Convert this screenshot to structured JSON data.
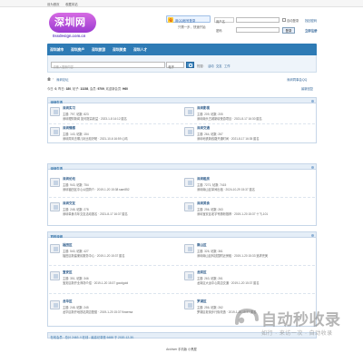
{
  "topbar": {
    "set_home": "设为首页",
    "bookmark": "收藏本站"
  },
  "logo": {
    "text": "深圳网",
    "url": "0ssdesign.com.cn"
  },
  "qq": {
    "badge": "Q",
    "button": "用QQ帐号登录",
    "sub": "只需一步，快速开始"
  },
  "login": {
    "account_select": "用户名",
    "password_label": "密码",
    "remember": "自动登录",
    "forgot": "找回密码",
    "submit": "登录",
    "register": "立即注册"
  },
  "nav": {
    "items": [
      "深圳城市",
      "深圳房产",
      "深圳旅游",
      "深圳美食",
      "深圳人才"
    ]
  },
  "search": {
    "placeholder": "请输入搜索内容",
    "scope": "帖子",
    "hot_label": "热搜:",
    "hot": [
      "活动",
      "交友",
      "工作"
    ]
  },
  "breadcrumb": {
    "current": "深圳论坛",
    "right": "深圳同事会QQ"
  },
  "stats": {
    "today_label": "今日:",
    "today": "0",
    "yesterday_label": "昨日:",
    "yesterday": "180",
    "posts_label": "帖子:",
    "posts": "11158",
    "members_label": "会员:",
    "members": "9709",
    "newest_label": "欢迎新会员:",
    "newest": "H60",
    "latest_link": "最新回复"
  },
  "sections": [
    {
      "title": "深圳生活",
      "forums": [
        {
          "name": "深圳实习",
          "count": "主题: 797, 帖数: 823",
          "last": "深圳理财新闻 如何提高收益 · 2023-1-8 14:12 匿名"
        },
        {
          "name": "深圳影视",
          "count": "主题: 209, 帖数: 205",
          "last": "深圳南头古城新增夜游项目 · 2021-8-17 16:30 匿名"
        },
        {
          "name": "深圳情感",
          "count": "主题: 143, 帖数: 154",
          "last": "深圳周末去哪儿玩比较好呢 · 2021-10-6 16:59 心晴"
        },
        {
          "name": "深圳交通",
          "count": "主题: 264, 帖数: 267",
          "last": "深圳地铁新线路开通时间 · 2021-8-17 16:35 匿名"
        }
      ]
    },
    {
      "title": "深圳生活",
      "forums": [
        {
          "name": "深圳论坛",
          "count": "主题: 943, 帖数: 754",
          "last": "深圳福田区中心公园简介 · 2019-1-20 15:38 sam852"
        },
        {
          "name": "深圳租房",
          "count": "主题: 7271, 帖数: 7415",
          "last": "深圳南山区单间出租 · 2024-10-29 15:37 匿名"
        },
        {
          "name": "深圳交友",
          "count": "主题: 248, 帖数: 278",
          "last": "深圳单身青年交友活动报名 · 2021-8-17 16:37 匿名"
        },
        {
          "name": "深圳美食",
          "count": "主题: 256, 帖数: 263",
          "last": "深圳宝安区老字号肠粉推荐 · 2019-1-20 15:37 十飞-101"
        }
      ]
    },
    {
      "title": "百姓深圳",
      "forums": [
        {
          "name": "福田区",
          "count": "主题: 540, 帖数: 427",
          "last": "福田区新建便民服务中心 · 2019-1-20 15:37 匿名"
        },
        {
          "name": "南山区",
          "count": "主题: 326, 帖数: 361",
          "last": "深圳南山区科技园附近房租 · 2019-1-20 15:33 追求完美"
        },
        {
          "name": "宝安区",
          "count": "主题: 351, 帖数: 346",
          "last": "宝安区新开业商场介绍 · 2019-1-20 15:37 goodgold"
        },
        {
          "name": "龙岗区",
          "count": "主题: 263, 帖数: 261",
          "last": "龙岗区大运中心周边交通 · 2019-1-20 15:37 匿名"
        },
        {
          "name": "龙华区",
          "count": "主题: 248, 帖数: 245",
          "last": "龙华区新开地铁站周边配套 · 2019-1-20 15:37 flowersa"
        },
        {
          "name": "罗湖区",
          "count": "主题: 256, 帖数: 262",
          "last": "罗湖区老街步行街改造 · 2019-1-20 15:37 匿名"
        }
      ]
    }
  ],
  "online": "在线会员 - 总计 2463 人在线 - 最高记录是 6488 于 2020-12-30.",
  "footer": "Archiver 手机版 小黑屋",
  "watermark": {
    "title": "自动秒收录",
    "sub": "如行 · 来访一次 · 自动收录"
  }
}
